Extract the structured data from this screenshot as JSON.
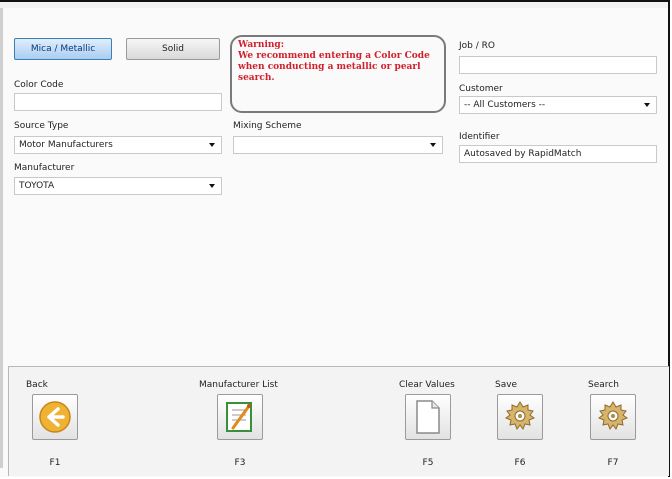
{
  "toggles": {
    "mica_metallic": "Mica / Metallic",
    "solid": "Solid"
  },
  "warning": {
    "title": "Warning:",
    "message": "We recommend entering a Color Code when conducting a metallic or pearl search."
  },
  "color_code": {
    "label": "Color Code",
    "value": ""
  },
  "source_type": {
    "label": "Source Type",
    "value": "Motor Manufacturers"
  },
  "manufacturer": {
    "label": "Manufacturer",
    "value": "TOYOTA"
  },
  "mixing_scheme": {
    "label": "Mixing Scheme",
    "value": ""
  },
  "job_ro": {
    "label": "Job / RO",
    "value": ""
  },
  "customer": {
    "label": "Customer",
    "value": "-- All Customers --"
  },
  "identifier": {
    "label": "Identifier",
    "value": "Autosaved by RapidMatch"
  },
  "footer": {
    "back": {
      "label": "Back",
      "key": "F1",
      "icon": "back-arrow-icon"
    },
    "manufacturer_list": {
      "label": "Manufacturer List",
      "key": "F3",
      "icon": "manufacturer-list-icon"
    },
    "clear_values": {
      "label": "Clear Values",
      "key": "F5",
      "icon": "blank-page-icon"
    },
    "save": {
      "label": "Save",
      "key": "F6",
      "icon": "gear-icon"
    },
    "search": {
      "label": "Search",
      "key": "F7",
      "icon": "gear-icon"
    }
  },
  "colors": {
    "warning_text": "#d11f2c",
    "active_toggle": "#a9cdf2",
    "back_icon": "#e9a21a",
    "gear": "#c9a25a"
  }
}
